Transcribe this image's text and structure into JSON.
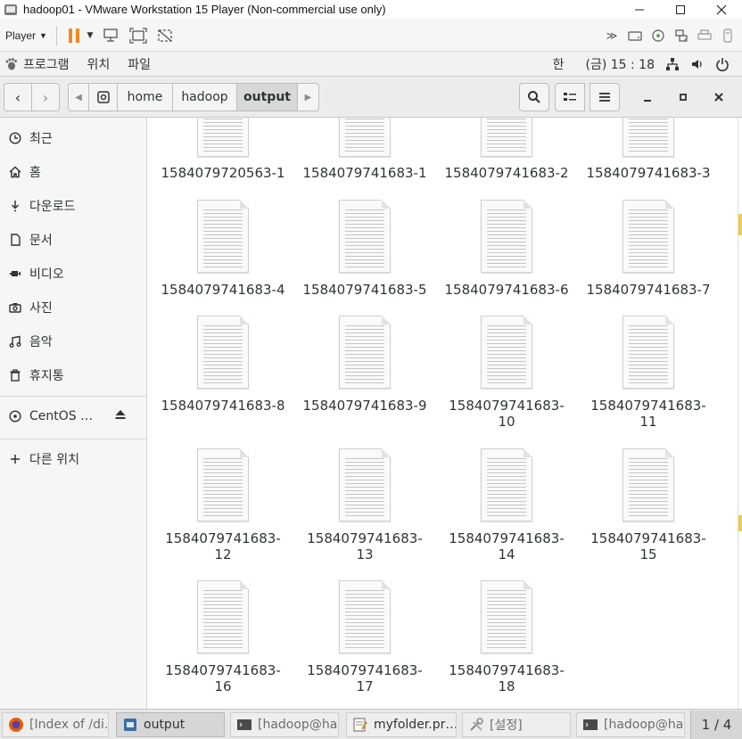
{
  "window": {
    "title": "hadoop01 - VMware Workstation 15 Player (Non-commercial use only)",
    "minimize_icon": "minimize-icon",
    "maximize_icon": "maximize-icon",
    "close_icon": "close-icon"
  },
  "vm_toolbar": {
    "player_label": "Player",
    "icons": [
      "pause-icon",
      "send-ctrl-alt-del-icon",
      "fullscreen-icon",
      "unity-icon"
    ],
    "right_icons": [
      "more-icon",
      "hdd-icon",
      "cd-icon",
      "network-icon",
      "printer-icon",
      "usb-icon"
    ]
  },
  "gnome_bar": {
    "apps_label": "프로그램",
    "places_label": "위치",
    "files_label": "파일",
    "input_method": "한",
    "clock": "(금) 15 : 18"
  },
  "header": {
    "path": [
      "home",
      "hadoop",
      "output"
    ],
    "active_segment": "output"
  },
  "sidebar": {
    "items": [
      {
        "label": "최근",
        "icon": "clock-icon"
      },
      {
        "label": "홈",
        "icon": "home-icon"
      },
      {
        "label": "다운로드",
        "icon": "download-icon"
      },
      {
        "label": "문서",
        "icon": "document-icon"
      },
      {
        "label": "비디오",
        "icon": "video-icon"
      },
      {
        "label": "사진",
        "icon": "camera-icon"
      },
      {
        "label": "음악",
        "icon": "music-icon"
      },
      {
        "label": "휴지통",
        "icon": "trash-icon"
      }
    ],
    "device": {
      "label": "CentOS …",
      "icon": "disc-icon"
    },
    "other": {
      "label": "다른 위치",
      "icon": "plus-icon"
    }
  },
  "files": {
    "row0": [
      "1584079720563-1",
      "1584079741683-1",
      "1584079741683-2",
      "1584079741683-3"
    ],
    "row1": [
      "1584079741683-4",
      "1584079741683-5",
      "1584079741683-6",
      "1584079741683-7"
    ],
    "row2": [
      {
        "l1": "1584079741683-8",
        "l2": ""
      },
      {
        "l1": "1584079741683-9",
        "l2": ""
      },
      {
        "l1": "1584079741683-",
        "l2": "10"
      },
      {
        "l1": "1584079741683-",
        "l2": "11"
      }
    ],
    "row3": [
      {
        "l1": "1584079741683-",
        "l2": "12"
      },
      {
        "l1": "1584079741683-",
        "l2": "13"
      },
      {
        "l1": "1584079741683-",
        "l2": "14"
      },
      {
        "l1": "1584079741683-",
        "l2": "15"
      }
    ],
    "row4": [
      {
        "l1": "1584079741683-",
        "l2": "16"
      },
      {
        "l1": "1584079741683-",
        "l2": "17"
      },
      {
        "l1": "1584079741683-",
        "l2": "18"
      }
    ]
  },
  "taskbar": {
    "tasks": [
      "[Index of /di…",
      "output",
      "[hadoop@ha…",
      "myfolder.pr…",
      "[설정]",
      "[hadoop@ha…"
    ],
    "workspace": "1 / 4"
  }
}
